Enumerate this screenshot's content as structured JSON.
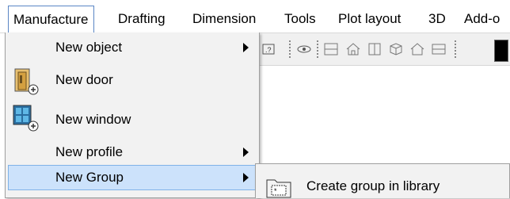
{
  "menubar": {
    "items": [
      {
        "label": "Manufacture",
        "active": true
      },
      {
        "label": "Drafting"
      },
      {
        "label": "Dimension"
      },
      {
        "label": "Tools"
      },
      {
        "label": "Plot layout"
      },
      {
        "label": "3D"
      },
      {
        "label": "Add-o"
      }
    ]
  },
  "dropdown": {
    "items": [
      {
        "label": "New object",
        "has_submenu": true
      },
      {
        "label": "New door",
        "icon": "door-icon"
      },
      {
        "label": "New window",
        "icon": "window-icon"
      },
      {
        "label": "New profile",
        "has_submenu": true
      },
      {
        "label": "New Group",
        "has_submenu": true,
        "highlighted": true
      }
    ]
  },
  "submenu": {
    "items": [
      {
        "label": "Create group in library",
        "icon": "folder-group-icon"
      }
    ]
  },
  "toolbar": {
    "icons": [
      "zoom-icon",
      "eye-icon",
      "floor-plan-icon",
      "house-icon",
      "panel-icon",
      "cube-icon",
      "house-outline-icon",
      "frame-icon",
      "color-swatch-icon"
    ]
  },
  "colors": {
    "highlight": "#cce2fb",
    "highlight_border": "#7fb2e8",
    "menu_bg": "#f2f2f2",
    "active_menu_border": "#5a86c5"
  }
}
